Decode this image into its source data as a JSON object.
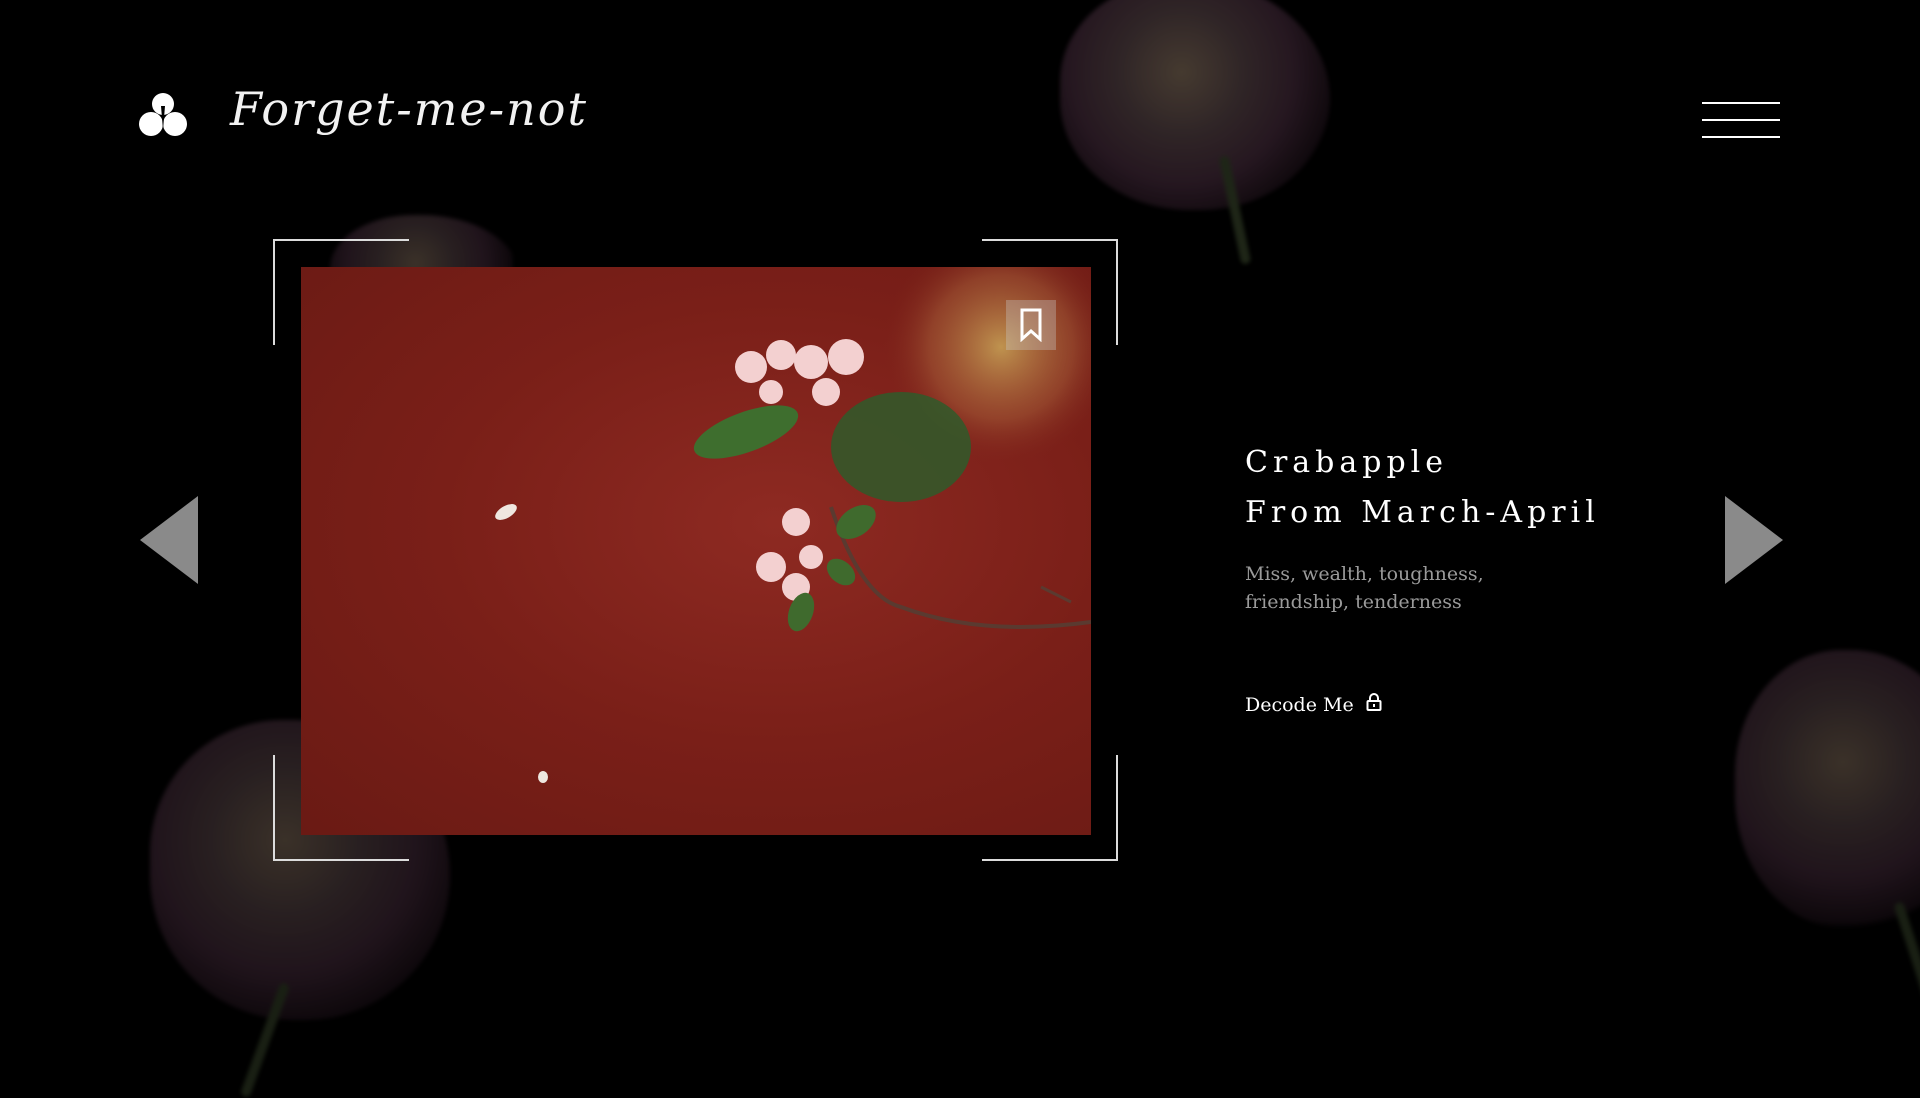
{
  "app": {
    "brand_name": "Forget-me-not"
  },
  "header": {
    "logo_icon": "flower-bud-icon",
    "menu_icon": "hamburger-menu-icon"
  },
  "gallery": {
    "bookmark_icon": "bookmark-icon",
    "prev_icon": "triangle-left-icon",
    "next_icon": "triangle-right-icon"
  },
  "flower": {
    "name": "Crabapple",
    "season": "From March-April",
    "meaning_line1": "Miss, wealth, toughness,",
    "meaning_line2": "friendship, tenderness",
    "decode_label": "Decode Me",
    "decode_icon": "lock-icon"
  },
  "colors": {
    "background": "#000000",
    "photo_red": "#7a1f18",
    "text_primary": "#ffffff",
    "text_muted": "#9a9a9a",
    "arrow_gray": "#8a8a8a"
  }
}
